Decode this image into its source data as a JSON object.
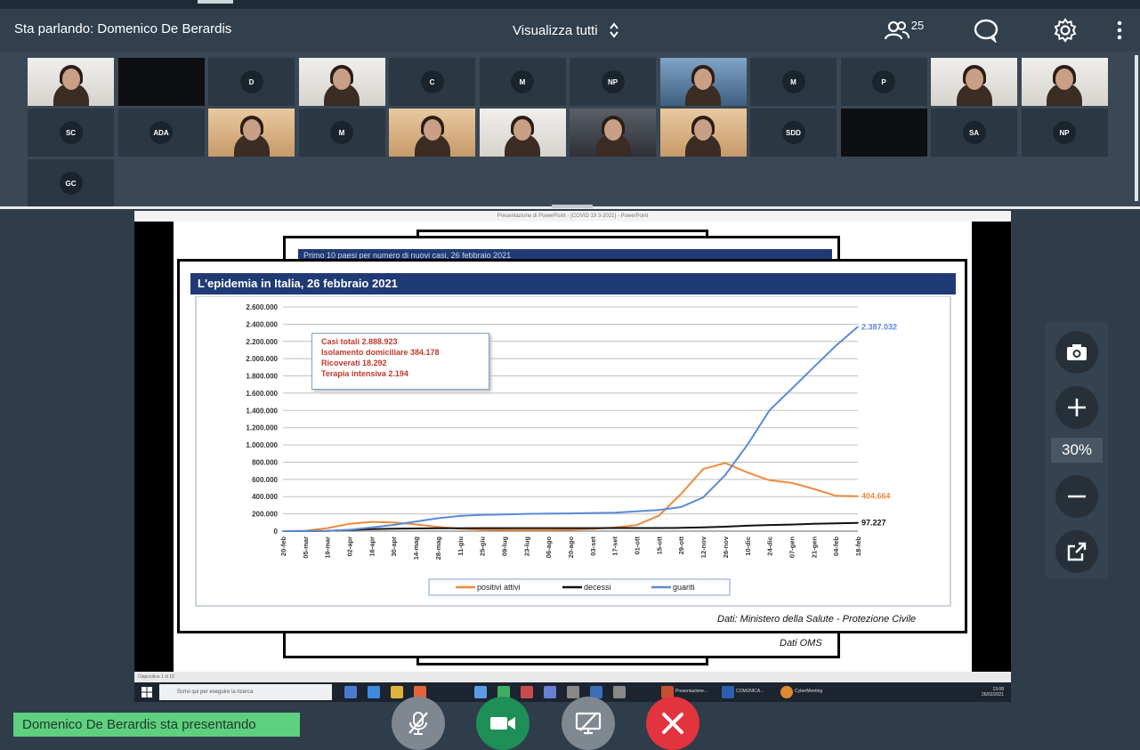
{
  "header": {
    "speaking_label": "Sta parlando: Domenico De Berardis",
    "view_all_label": "Visualizza tutti",
    "participant_count": "25",
    "participants_icon": "participants-icon",
    "chat_icon": "chat-icon",
    "settings_icon": "gear-icon",
    "more_icon": "more-vertical-icon"
  },
  "participants": [
    {
      "initials": "",
      "type": "cam",
      "tone": "white"
    },
    {
      "initials": "",
      "type": "black"
    },
    {
      "initials": "D",
      "type": "avatar"
    },
    {
      "initials": "",
      "type": "cam",
      "tone": "white"
    },
    {
      "initials": "C",
      "type": "avatar"
    },
    {
      "initials": "M",
      "type": "avatar"
    },
    {
      "initials": "NP",
      "type": "avatar"
    },
    {
      "initials": "",
      "type": "cam",
      "tone": "blue"
    },
    {
      "initials": "M",
      "type": "avatar"
    },
    {
      "initials": "P",
      "type": "avatar"
    },
    {
      "initials": "",
      "type": "cam",
      "tone": "white"
    },
    {
      "initials": "",
      "type": "cam",
      "tone": "white"
    },
    {
      "initials": "SC",
      "type": "avatar"
    },
    {
      "initials": "ADA",
      "type": "avatar"
    },
    {
      "initials": "",
      "type": "cam",
      "tone": "warm"
    },
    {
      "initials": "M",
      "type": "avatar"
    },
    {
      "initials": "",
      "type": "cam",
      "tone": "warm"
    },
    {
      "initials": "",
      "type": "cam",
      "tone": "white"
    },
    {
      "initials": "",
      "type": "cam",
      "tone": "dark"
    },
    {
      "initials": "",
      "type": "cam",
      "tone": "warm"
    },
    {
      "initials": "SDD",
      "type": "avatar"
    },
    {
      "initials": "",
      "type": "black"
    },
    {
      "initials": "SA",
      "type": "avatar"
    },
    {
      "initials": "NP",
      "type": "avatar"
    },
    {
      "initials": "GC",
      "type": "avatar"
    }
  ],
  "shared_screen": {
    "window_title": "Presentazione di PowerPoint - [COVID 19 3-2021] - PowerPoint",
    "back_slide_title": "Primo 10 paesi per numero di nuovi casi, 26 febbraio 2021",
    "slide_title": "L'epidemia in Italia, 26 febbraio 2021",
    "source_front": "Dati: Ministero della Salute - Protezione Civile",
    "source_back": "Dati OMS",
    "status_text": "Diapositiva 1 di 16",
    "infobox": [
      "Casi totali 2.888.923",
      "Isolamento domiciliare 384.178",
      "Ricoverati 18.292",
      "Terapia intensiva 2.194"
    ],
    "taskbar": {
      "search_placeholder": "Scrivi qui per eseguire la ricerca",
      "apps": [
        "Presentazione...",
        "COMUNICA...",
        "CyberMeeting"
      ],
      "time": "13:08",
      "date": "26/02/2021"
    }
  },
  "chart_data": {
    "type": "line",
    "title": "L'epidemia in Italia, 26 febbraio 2021",
    "categories": [
      "20-feb",
      "05-mar",
      "19-mar",
      "02-apr",
      "16-apr",
      "30-apr",
      "14-mag",
      "28-mag",
      "11-giu",
      "25-giu",
      "09-lug",
      "23-lug",
      "06-ago",
      "20-ago",
      "03-set",
      "17-set",
      "01-ott",
      "15-ott",
      "29-ott",
      "12-nov",
      "26-nov",
      "10-dic",
      "24-dic",
      "07-gen",
      "21-gen",
      "04-feb",
      "18-feb"
    ],
    "ylim": [
      0,
      2600000
    ],
    "yticks": [
      "0",
      "200.000",
      "400.000",
      "600.000",
      "800.000",
      "1.000.000",
      "1.200.000",
      "1.400.000",
      "1.600.000",
      "1.800.000",
      "2.000.000",
      "2.200.000",
      "2.400.000",
      "2.600.000"
    ],
    "series": [
      {
        "name": "positivi attivi",
        "color": "#ed8b3f",
        "end_label": "404.664",
        "values": [
          0,
          4000,
          35000,
          85000,
          107000,
          100000,
          78000,
          50000,
          28000,
          18000,
          14000,
          12500,
          13000,
          17000,
          26000,
          42000,
          70000,
          180000,
          430000,
          720000,
          790000,
          680000,
          590000,
          560000,
          490000,
          410000,
          405000
        ]
      },
      {
        "name": "decessi",
        "color": "#111111",
        "end_label": "97.227",
        "values": [
          0,
          150,
          3400,
          14000,
          22700,
          27900,
          31000,
          33000,
          34200,
          34700,
          34900,
          35100,
          35200,
          35400,
          35500,
          35700,
          36000,
          36500,
          38600,
          44100,
          51300,
          62600,
          71600,
          76300,
          85200,
          91300,
          96000
        ]
      },
      {
        "name": "guariti",
        "color": "#5b8ad6",
        "end_label": "2.387.032",
        "values": [
          0,
          600,
          3000,
          15000,
          42000,
          72000,
          110000,
          150000,
          176000,
          189000,
          194000,
          200000,
          203000,
          205000,
          210000,
          215000,
          230000,
          245000,
          280000,
          390000,
          650000,
          1000000,
          1400000,
          1650000,
          1900000,
          2150000,
          2370000
        ]
      }
    ],
    "legend": [
      "positivi attivi",
      "decessi",
      "guariti"
    ],
    "legend_position": "bottom"
  },
  "zoom": {
    "level": "30%",
    "camera_icon": "camera-icon",
    "zoom_in_icon": "plus-icon",
    "zoom_out_icon": "minus-icon",
    "popout_icon": "popout-icon"
  },
  "footer": {
    "presenting_label": "Domenico De Berardis sta presentando",
    "mic_icon": "mic-off-icon",
    "camera_icon": "video-icon",
    "share_icon": "share-screen-off-icon",
    "hangup_icon": "close-icon",
    "colors": {
      "mic": "#7f8891",
      "camera": "#1e8f57",
      "share": "#7f8891",
      "hangup": "#e2333f"
    }
  }
}
